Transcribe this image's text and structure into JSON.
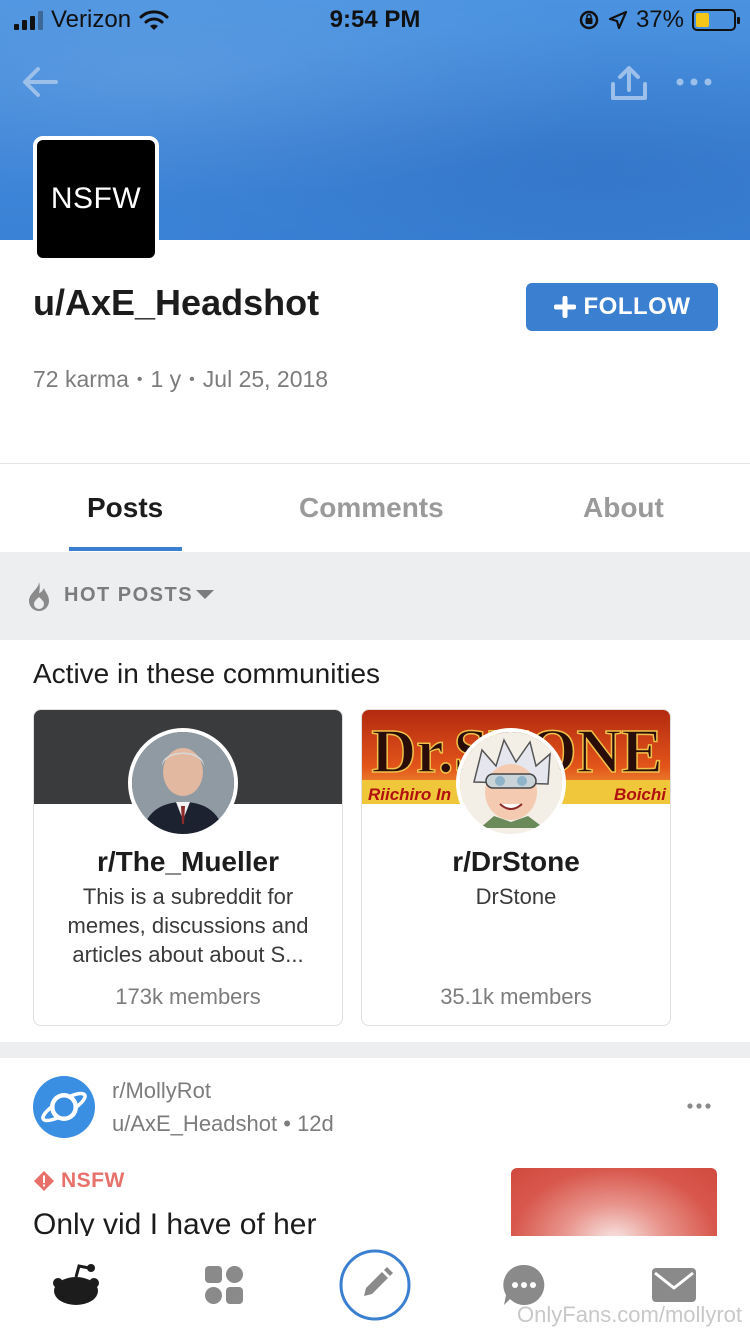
{
  "status_bar": {
    "carrier": "Verizon",
    "time": "9:54 PM",
    "battery": "37%",
    "battery_level": 0.37
  },
  "profile": {
    "avatar_text": "NSFW",
    "username": "u/AxE_Headshot",
    "follow_label": "FOLLOW",
    "karma": "72 karma",
    "age": "1 y",
    "joined": "Jul 25, 2018"
  },
  "tabs": [
    {
      "label": "Posts",
      "active": true
    },
    {
      "label": "Comments",
      "active": false
    },
    {
      "label": "About",
      "active": false
    }
  ],
  "sort": {
    "label": "HOT POSTS"
  },
  "communities": {
    "title": "Active in these communities",
    "cards": [
      {
        "name": "r/The_Mueller",
        "description": "This is a subreddit for memes, discussions and articles about about S...",
        "members": "173k members"
      },
      {
        "name": "r/DrStone",
        "description": "DrStone",
        "members": "35.1k members",
        "banner_text": "Dr.STONE",
        "banner_left": "Riichiro In",
        "banner_right": "Boichi"
      }
    ]
  },
  "post": {
    "subreddit": "r/MollyRot",
    "author": "u/AxE_Headshot",
    "age": "12d",
    "tag": "NSFW",
    "title": "Only vid I have of her"
  },
  "bottom_nav": [
    {
      "icon": "reddit-home-icon"
    },
    {
      "icon": "communities-grid-icon"
    },
    {
      "icon": "create-post-icon"
    },
    {
      "icon": "chat-icon"
    },
    {
      "icon": "inbox-icon"
    }
  ],
  "watermark": "OnlyFans.com/mollyrot",
  "colors": {
    "accent": "#3b7fd0",
    "banner": "#4289da",
    "nsfw": "#e8706b",
    "battery": "#f5c518"
  }
}
